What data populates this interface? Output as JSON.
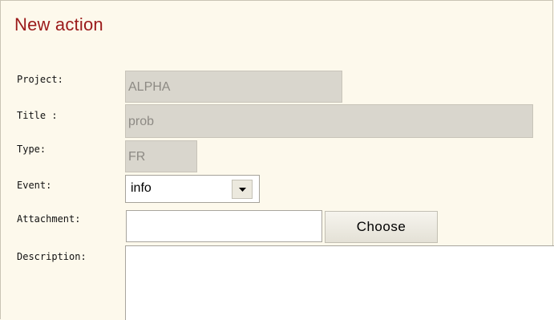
{
  "page": {
    "title": "New action"
  },
  "form": {
    "project": {
      "label": "Project:",
      "value": "ALPHA"
    },
    "title": {
      "label": "Title :",
      "value": "prob"
    },
    "type": {
      "label": "Type:",
      "value": "FR"
    },
    "event": {
      "label": "Event:",
      "selected": "info",
      "icon": "chevron-down-icon"
    },
    "attachment": {
      "label": "Attachment:",
      "value": "",
      "button_label": "Choose"
    },
    "description": {
      "label": "Description:",
      "value": ""
    }
  },
  "colors": {
    "background": "#fdf9ec",
    "title": "#9b1a1a",
    "readonly_field": "#d9d6cd",
    "readonly_text": "#8d8a84"
  }
}
